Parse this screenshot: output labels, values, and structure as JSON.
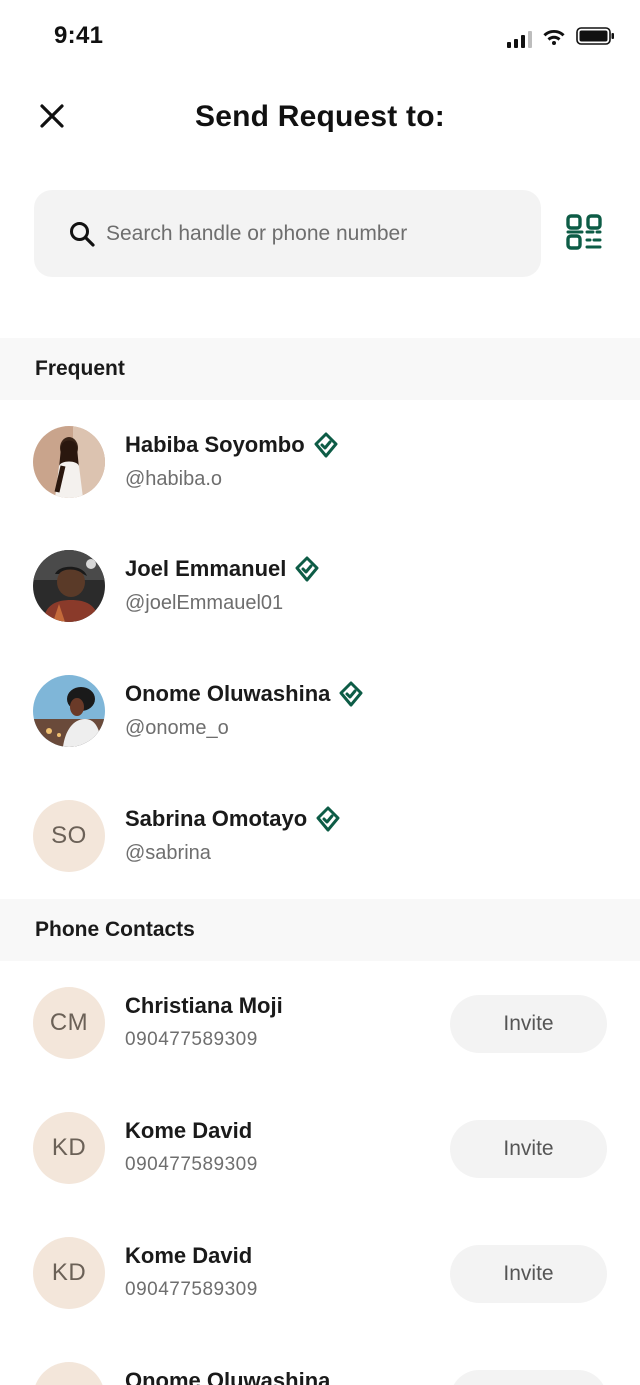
{
  "status": {
    "time": "9:41"
  },
  "header": {
    "title": "Send Request to:"
  },
  "search": {
    "placeholder": "Search handle or phone number"
  },
  "frequent": {
    "title": "Frequent",
    "contacts": [
      {
        "name": "Habiba Soyombo",
        "handle": "@habiba.o"
      },
      {
        "name": "Joel Emmanuel",
        "handle": "@joelEmmauel01"
      },
      {
        "name": "Onome Oluwashina",
        "handle": "@onome_o"
      },
      {
        "name": "Sabrina Omotayo",
        "handle": "@sabrina",
        "initials": "SO"
      }
    ]
  },
  "phone_contacts": {
    "title": "Phone Contacts",
    "invite_label": "Invite",
    "contacts": [
      {
        "initials": "CM",
        "name": "Christiana Moji",
        "phone": "090477589309"
      },
      {
        "initials": "KD",
        "name": "Kome David",
        "phone": "090477589309"
      },
      {
        "initials": "KD",
        "name": "Kome David",
        "phone": "090477589309"
      },
      {
        "initials": "",
        "name": "Onome Oluwashina",
        "phone": ""
      }
    ]
  },
  "colors": {
    "accent": "#0d5c46",
    "avatar_bg": "#f3e6da",
    "section_bg": "#f8f8f8",
    "input_bg": "#f3f3f3"
  }
}
